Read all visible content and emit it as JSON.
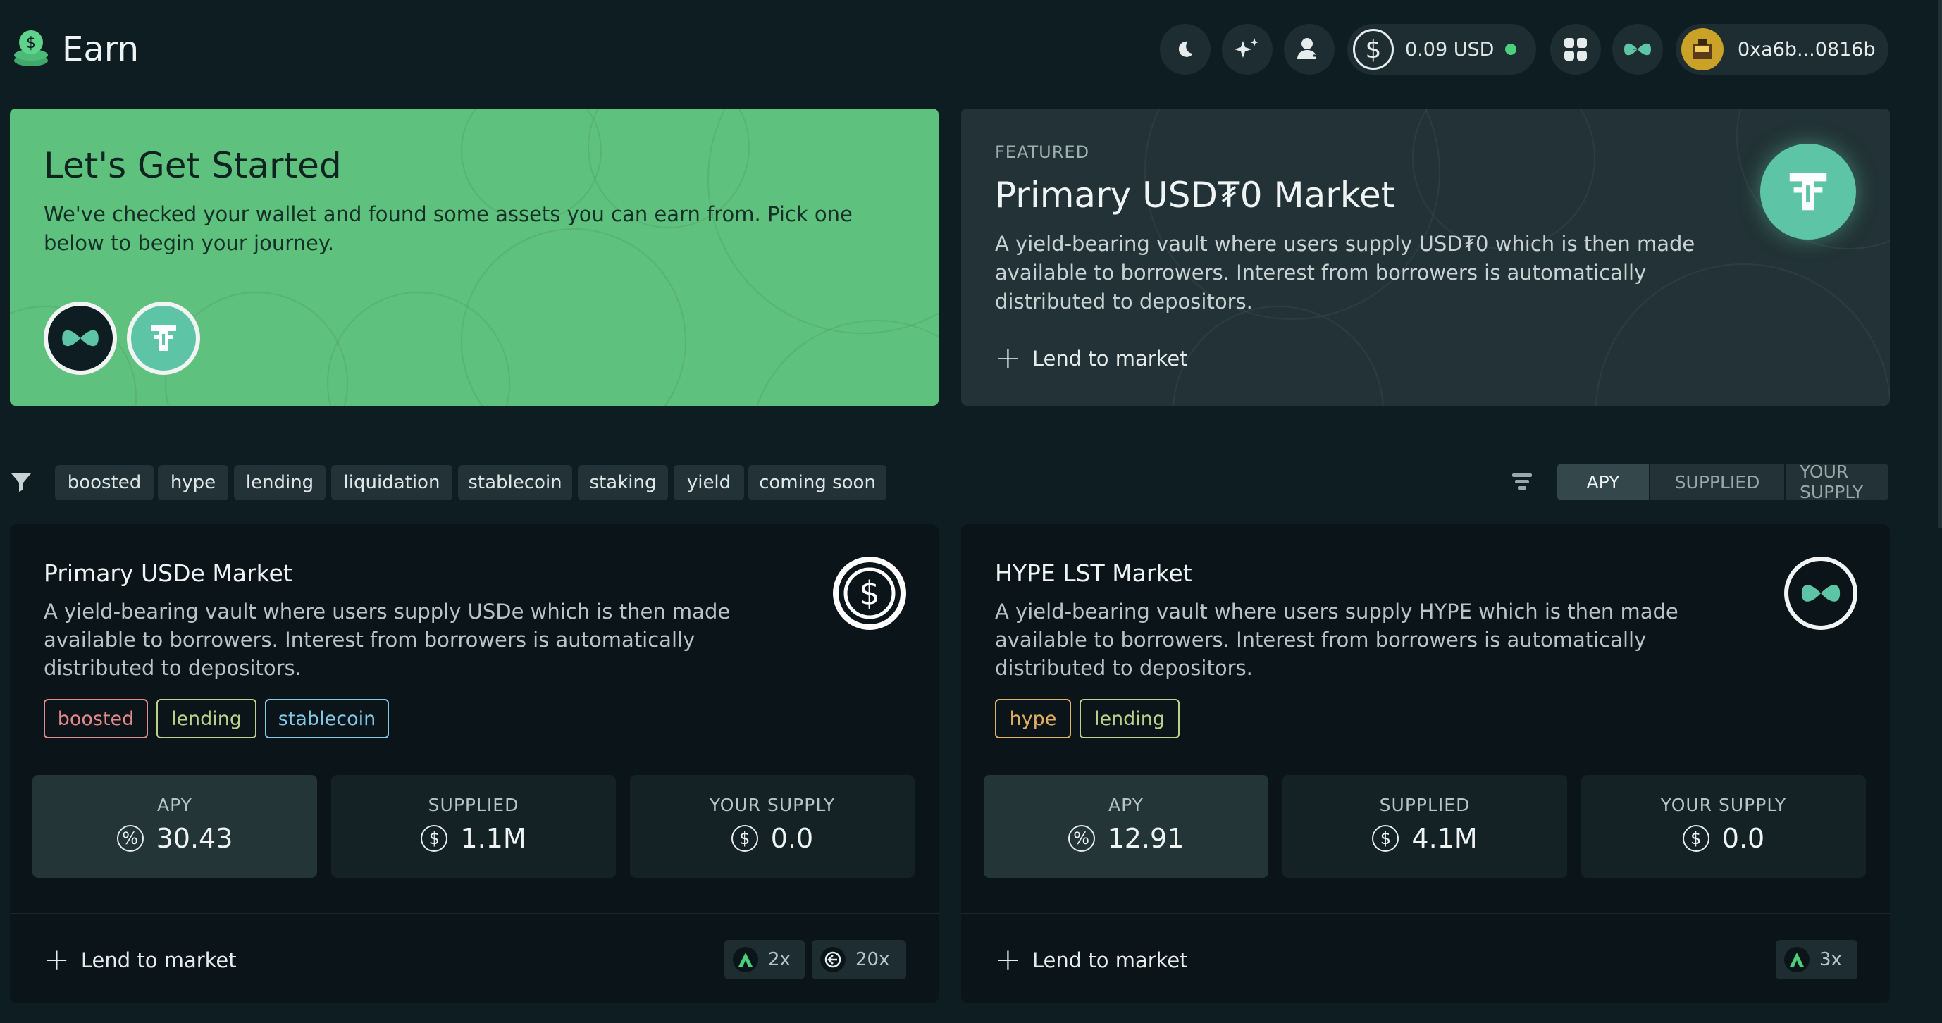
{
  "header": {
    "title": "Earn",
    "balance": "0.09 USD",
    "dollar_glyph": "$",
    "wallet_address": "0xa6b...0816b",
    "icons": [
      "moon-icon",
      "sparkles-icon",
      "user-add-icon",
      "dollar-icon",
      "grid-apps-icon",
      "hype-logo-icon",
      "wallet-avatar-icon"
    ]
  },
  "hero": {
    "title": "Let's Get Started",
    "text": "We've checked your wallet and found some assets you can earn from. Pick one below to begin your journey."
  },
  "featured": {
    "label": "FEATURED",
    "title": "Primary USD₮0 Market",
    "text": "A yield-bearing vault where users supply USD₮0 which is then made available to borrowers. Interest from borrowers is automatically distributed to depositors.",
    "action": "Lend to market"
  },
  "filters": {
    "tags": [
      "boosted",
      "hype",
      "lending",
      "liquidation",
      "stablecoin",
      "staking",
      "yield",
      "coming soon"
    ],
    "sort": [
      "APY",
      "SUPPLIED",
      "YOUR SUPPLY"
    ],
    "active_sort": "APY"
  },
  "markets": [
    {
      "title": "Primary USDe Market",
      "text": "A yield-bearing vault where users supply USDe which is then made available to borrowers. Interest from borrowers is automatically distributed to depositors.",
      "tags": [
        "boosted",
        "lending",
        "stablecoin"
      ],
      "stats": {
        "apy_label": "APY",
        "apy": "30.43",
        "supplied_label": "SUPPLIED",
        "supplied": "1.1M",
        "your_label": "YOUR SUPPLY",
        "your": "0.0"
      },
      "action": "Lend to market",
      "multipliers": [
        "2x",
        "20x"
      ]
    },
    {
      "title": "HYPE LST Market",
      "text": "A yield-bearing vault where users supply HYPE which is then made available to borrowers. Interest from borrowers is automatically distributed to depositors.",
      "tags": [
        "hype",
        "lending"
      ],
      "stats": {
        "apy_label": "APY",
        "apy": "12.91",
        "supplied_label": "SUPPLIED",
        "supplied": "4.1M",
        "your_label": "YOUR SUPPLY",
        "your": "0.0"
      },
      "action": "Lend to market",
      "multipliers": [
        "3x"
      ]
    }
  ],
  "glyphs": {
    "percent": "%",
    "dollar": "$",
    "plus": "+"
  },
  "colors": {
    "background": "#0d1d22",
    "hero_green": "#5fc17e",
    "accent_teal": "#5ec4a6",
    "status_green": "#4ccf7a",
    "tag_boosted": "#e58a8a",
    "tag_lending": "#b9d38b",
    "tag_stablecoin": "#7fc9e6",
    "tag_hype": "#e2b063"
  }
}
